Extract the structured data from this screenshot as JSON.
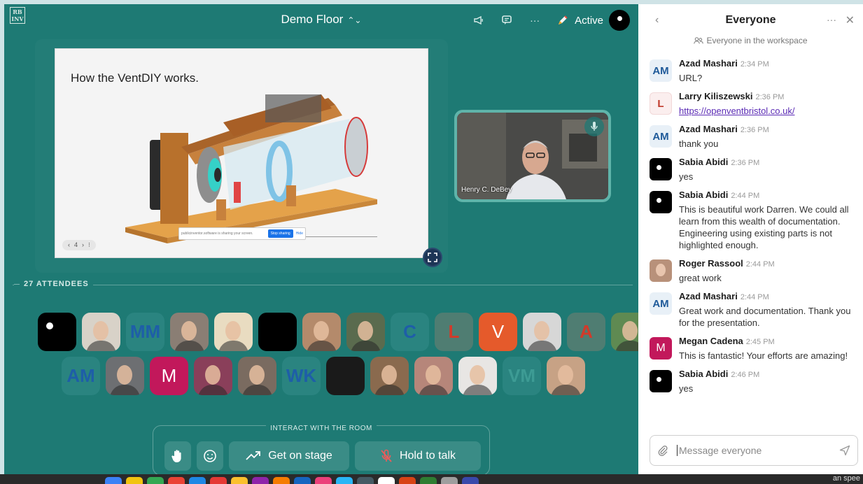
{
  "app": {
    "logo": "RB\nINV",
    "room_title": "Demo Floor"
  },
  "top_bar": {
    "status": "Active"
  },
  "stage": {
    "slide_title": "How the VentDIY works.",
    "slide_nav": [
      "‹",
      "4",
      "›",
      "⁝"
    ],
    "share_bar": {
      "text": "publicinventor.software is sharing your screen.",
      "stop": "Stop sharing",
      "hide": "Hide"
    }
  },
  "video": {
    "name": "Henry C. DeBey"
  },
  "attendees": {
    "label": "27 ATTENDEES",
    "row1": [
      {
        "kind": "black",
        "initials": ""
      },
      {
        "kind": "photo",
        "initials": "",
        "bg": "#d8d2c8"
      },
      {
        "kind": "initials",
        "initials": "MM",
        "bg": "#2a8480",
        "fg": "#1e5ea8"
      },
      {
        "kind": "photo",
        "initials": "",
        "bg": "#8a7e74"
      },
      {
        "kind": "photo",
        "initials": "",
        "bg": "#e9dcc1"
      },
      {
        "kind": "solid",
        "initials": "",
        "bg": "#000000"
      },
      {
        "kind": "photo",
        "initials": "",
        "bg": "#b48a6b"
      },
      {
        "kind": "photo",
        "initials": "",
        "bg": "#5a6b4e"
      },
      {
        "kind": "initials",
        "initials": "C",
        "bg": "#2a8480",
        "fg": "#1e5ea8"
      },
      {
        "kind": "initials",
        "initials": "L",
        "bg": "#4f7d72",
        "fg": "#d23a2a"
      },
      {
        "kind": "initials",
        "initials": "V",
        "bg": "#e55a2b",
        "fg": "#ffffff"
      },
      {
        "kind": "photo",
        "initials": "",
        "bg": "#d7d7d7"
      },
      {
        "kind": "initials",
        "initials": "A",
        "bg": "#4f7d72",
        "fg": "#d23a2a"
      },
      {
        "kind": "photo",
        "initials": "",
        "bg": "#5f8a52"
      }
    ],
    "row2": [
      {
        "kind": "initials",
        "initials": "AM",
        "bg": "#2a8480",
        "fg": "#1e5ea8"
      },
      {
        "kind": "photo",
        "initials": "",
        "bg": "#6d6f72"
      },
      {
        "kind": "initials",
        "initials": "M",
        "bg": "#c2185b",
        "fg": "#ffffff"
      },
      {
        "kind": "photo",
        "initials": "",
        "bg": "#8a3f5a"
      },
      {
        "kind": "photo",
        "initials": "",
        "bg": "#7a6b60"
      },
      {
        "kind": "initials",
        "initials": "WK",
        "bg": "#2a8480",
        "fg": "#1e5ea8"
      },
      {
        "kind": "solid",
        "initials": "",
        "bg": "#1a1a1a"
      },
      {
        "kind": "photo",
        "initials": "",
        "bg": "#8a6a4e"
      },
      {
        "kind": "photo",
        "initials": "",
        "bg": "#b6867a"
      },
      {
        "kind": "photo",
        "initials": "",
        "bg": "#e8e6e4"
      },
      {
        "kind": "initials",
        "initials": "VM",
        "bg": "#2a8480",
        "fg": "#3d9b94"
      },
      {
        "kind": "photo",
        "initials": "",
        "bg": "#c7a285"
      }
    ]
  },
  "interact": {
    "label": "INTERACT WITH THE ROOM",
    "get_on_stage": "Get on stage",
    "hold_to_talk": "Hold to talk"
  },
  "dock": {
    "text": "an spee"
  },
  "chat": {
    "title": "Everyone",
    "subtitle": "Everyone in the workspace",
    "messages": [
      {
        "avatar": "am",
        "initials": "AM",
        "name": "Azad Mashari",
        "time": "2:34 PM",
        "text": "URL?"
      },
      {
        "avatar": "l",
        "initials": "L",
        "name": "Larry Kiliszewski",
        "time": "2:36 PM",
        "text": "https://openventbristol.co.uk/",
        "link": true
      },
      {
        "avatar": "am",
        "initials": "AM",
        "name": "Azad Mashari",
        "time": "2:36 PM",
        "text": "thank you"
      },
      {
        "avatar": "black",
        "initials": "",
        "name": "Sabia Abidi",
        "time": "2:36 PM",
        "text": "yes"
      },
      {
        "avatar": "black",
        "initials": "",
        "name": "Sabia Abidi",
        "time": "2:44 PM",
        "text": "This is beautiful work Darren. We could all learn from this wealth of documentation. Engineering using existing parts is not highlighted enough."
      },
      {
        "avatar": "photo",
        "initials": "",
        "name": "Roger Rassool",
        "time": "2:44 PM",
        "text": "great work"
      },
      {
        "avatar": "am",
        "initials": "AM",
        "name": "Azad Mashari",
        "time": "2:44 PM",
        "text": "Great work and documentation. Thank you for the presentation."
      },
      {
        "avatar": "m",
        "initials": "M",
        "name": "Megan Cadena",
        "time": "2:45 PM",
        "text": "This is fantastic! Your efforts are amazing!"
      },
      {
        "avatar": "black",
        "initials": "",
        "name": "Sabia Abidi",
        "time": "2:46 PM",
        "text": "yes"
      }
    ],
    "composer_placeholder": "Message everyone"
  }
}
